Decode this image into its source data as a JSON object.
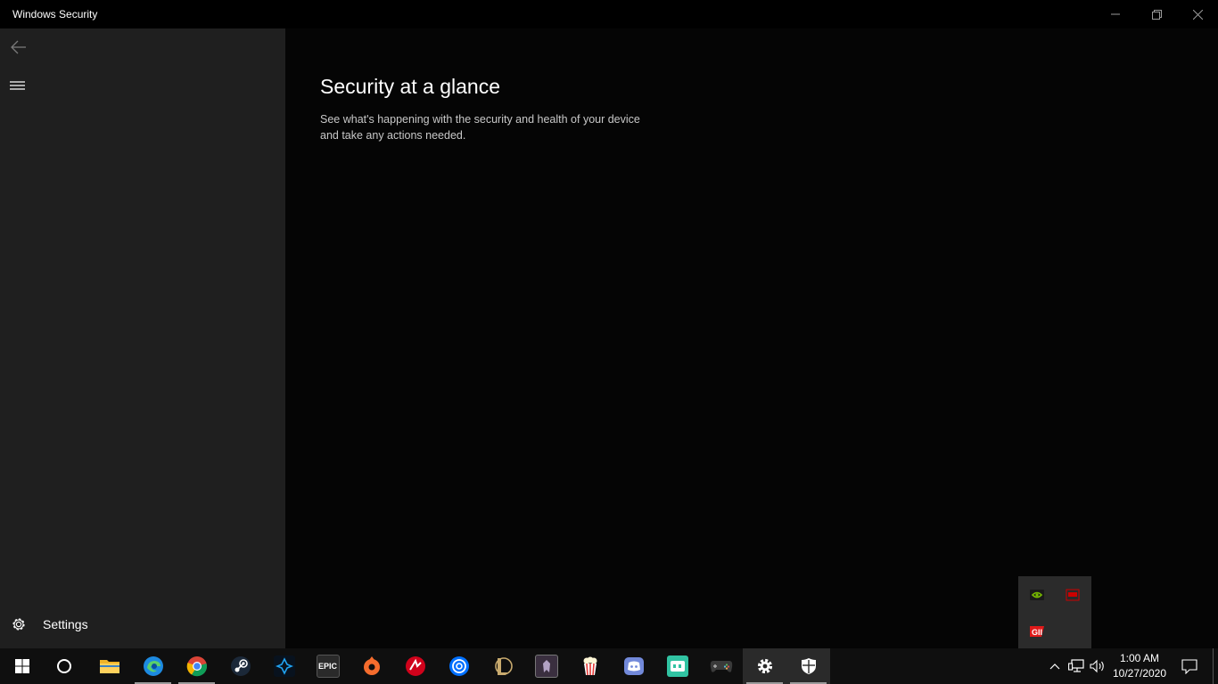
{
  "window": {
    "title": "Windows Security"
  },
  "sidebar": {
    "settings_label": "Settings"
  },
  "main": {
    "title": "Security at a glance",
    "description_line1": "See what's happening with the security and health of your device",
    "description_line2": "and take any actions needed."
  },
  "taskbar": {
    "apps": [
      {
        "name": "Cortana / Search"
      },
      {
        "name": "File Explorer"
      },
      {
        "name": "Microsoft Edge",
        "running": true
      },
      {
        "name": "Google Chrome",
        "running": true
      },
      {
        "name": "Steam"
      },
      {
        "name": "Battle.net"
      },
      {
        "name": "Epic Games Launcher",
        "text": "EPIC"
      },
      {
        "name": "Origin"
      },
      {
        "name": "Wargaming.net Game Center"
      },
      {
        "name": "Uplay"
      },
      {
        "name": "League of Legends"
      },
      {
        "name": "Diablo"
      },
      {
        "name": "Popcorn Time"
      },
      {
        "name": "Discord"
      },
      {
        "name": "Streamlabs OBS"
      },
      {
        "name": "Game Controller"
      },
      {
        "name": "Settings",
        "running": true
      },
      {
        "name": "Windows Security",
        "running": true
      }
    ],
    "clock_time": "1:00 AM",
    "clock_date": "10/27/2020"
  },
  "colors": {
    "sidebar_bg": "#1f1f1f",
    "main_bg": "#050505",
    "taskbar_bg": "#0f0f0f"
  }
}
